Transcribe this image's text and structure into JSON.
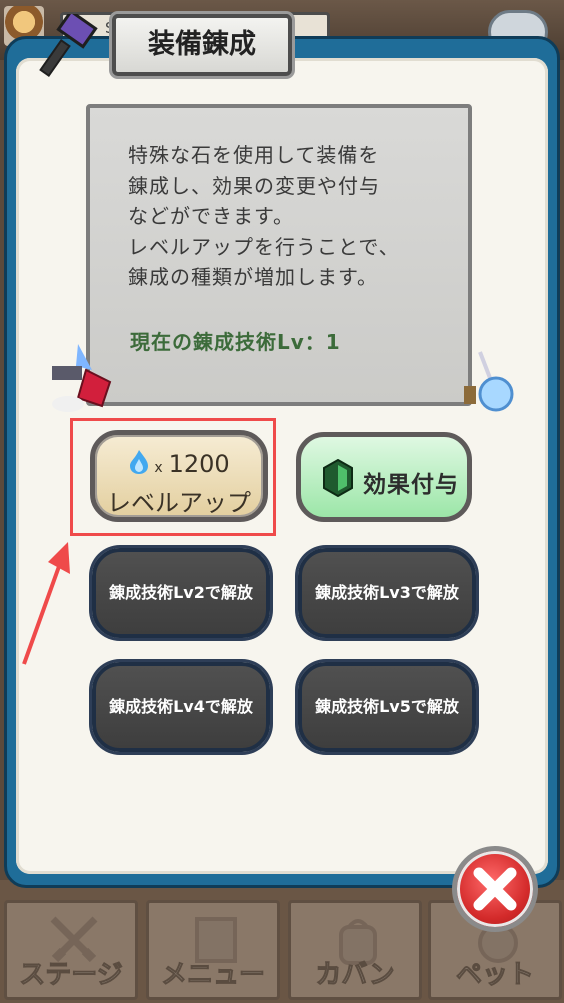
{
  "top_bar": {
    "player_name": "Sona"
  },
  "dialog": {
    "title": "装備錬成",
    "description": "特殊な石を使用して装備を\n錬成し、効果の変更や付与\nなどができます。\nレベルアップを行うことで、\n錬成の種類が増加します。",
    "skill_level": "現在の錬成技術Lv：1"
  },
  "buttons": {
    "level_up": {
      "cost_prefix": "x",
      "cost": "1200",
      "label": "レベルアップ"
    },
    "effect": {
      "label": "効果付与"
    },
    "locked": [
      {
        "label": "錬成技術Lv2で解放"
      },
      {
        "label": "錬成技術Lv3で解放"
      },
      {
        "label": "錬成技術Lv4で解放"
      },
      {
        "label": "錬成技術Lv5で解放"
      }
    ]
  },
  "bottom_nav": [
    {
      "label": "ステージ",
      "icon": "crossed-swords-icon"
    },
    {
      "label": "メニュー",
      "icon": "book-icon"
    },
    {
      "label": "カバン",
      "icon": "backpack-icon"
    },
    {
      "label": "ペット",
      "icon": "pet-icon"
    }
  ],
  "colors": {
    "frame_blue": "#1f6d99",
    "highlight_red": "#ef4a4a",
    "close_red": "#d32a2a",
    "skill_green": "#3c6b3a"
  }
}
